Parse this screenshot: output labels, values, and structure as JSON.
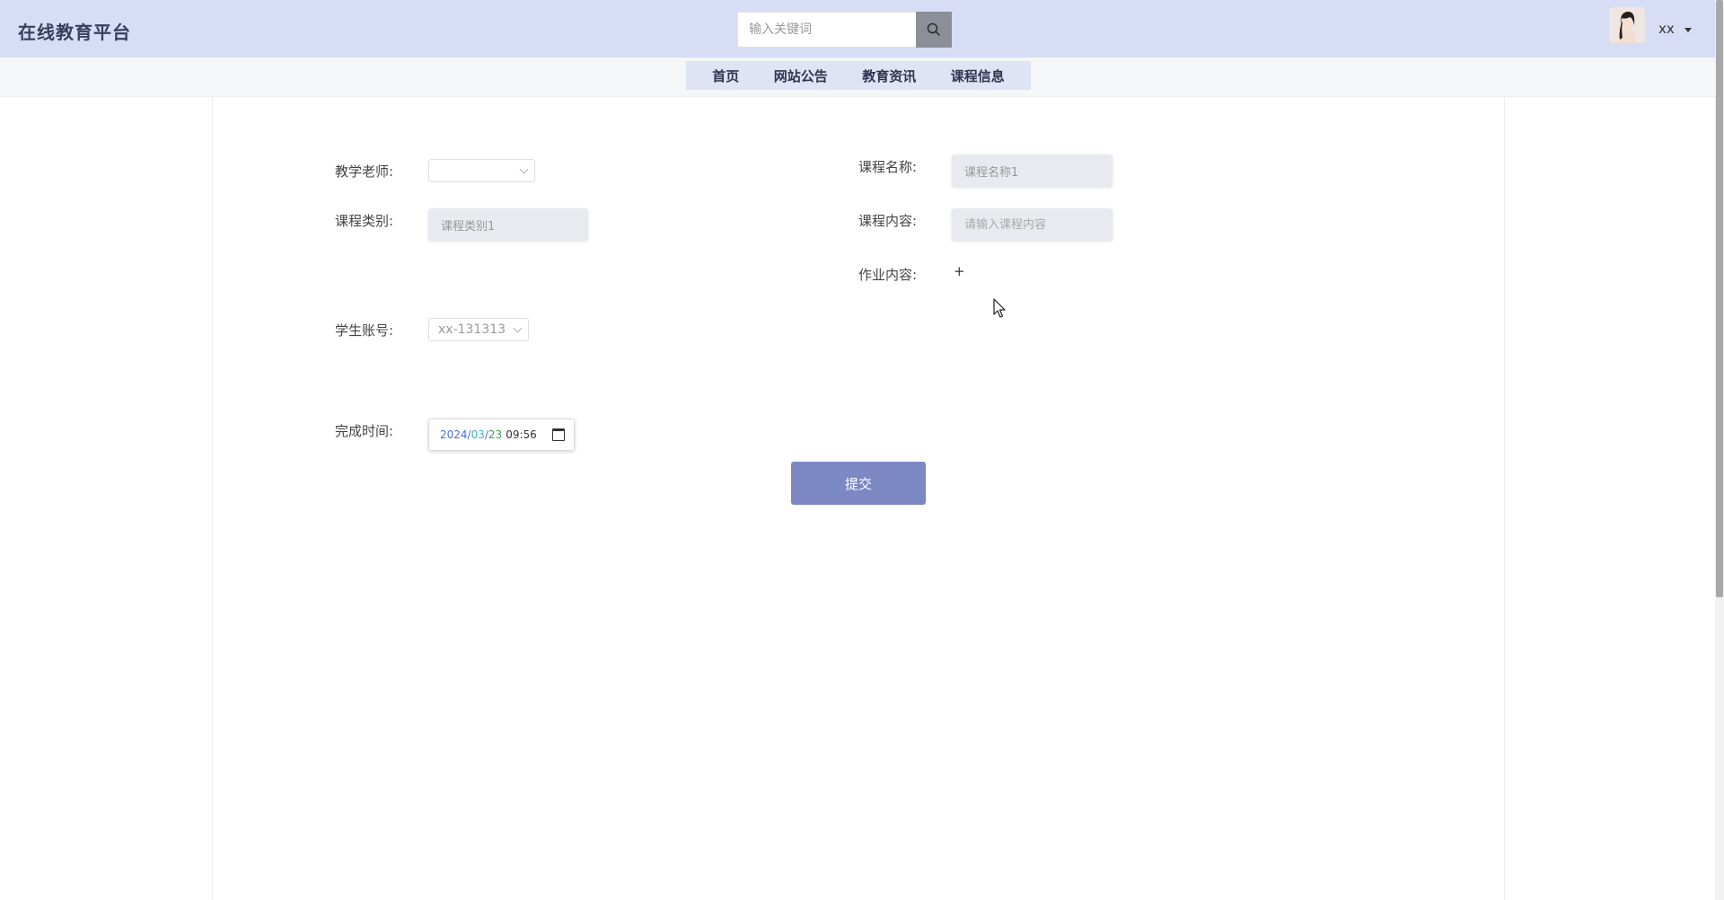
{
  "header": {
    "logo": "在线教育平台",
    "search": {
      "placeholder": "输入关键词",
      "button_icon": "search-icon"
    },
    "user": {
      "name": "xx",
      "avatar_icon": "user-avatar"
    }
  },
  "nav": {
    "items": [
      {
        "label": "首页"
      },
      {
        "label": "网站公告"
      },
      {
        "label": "教育资讯"
      },
      {
        "label": "课程信息"
      }
    ]
  },
  "form": {
    "teacher": {
      "label": "教学老师:",
      "value": ""
    },
    "course_name": {
      "label": "课程名称:",
      "value": "课程名称1"
    },
    "course_category": {
      "label": "课程类别:",
      "value": "课程类别1"
    },
    "course_content": {
      "label": "课程内容:",
      "placeholder": "请输入课程内容"
    },
    "homework": {
      "label": "作业内容:",
      "add_symbol": "+"
    },
    "student_account": {
      "label": "学生账号:",
      "value": "xx-131313"
    },
    "finish_time": {
      "label": "完成时间:",
      "year": "2024",
      "month": "03",
      "day": "23",
      "time": "09:56"
    },
    "submit_label": "提交"
  },
  "colors": {
    "header_bg": "#d6ddf5",
    "nav_bg": "#dfe4f4",
    "submit_bg": "#7b88c2",
    "logo_text": "#3a3f5c"
  }
}
